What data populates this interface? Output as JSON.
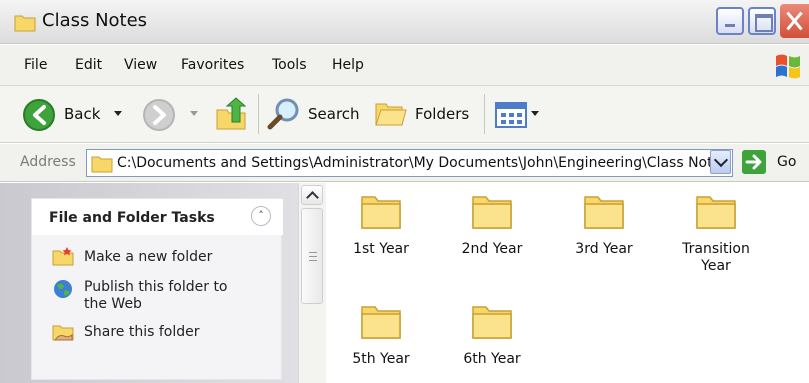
{
  "window": {
    "title": "Class Notes"
  },
  "menu": [
    "File",
    "Edit",
    "View",
    "Favorites",
    "Tools",
    "Help"
  ],
  "toolbar": {
    "back_label": "Back",
    "search_label": "Search",
    "folders_label": "Folders"
  },
  "address": {
    "label": "Address",
    "value": "C:\\Documents and Settings\\Administrator\\My Documents\\John\\Engineering\\Class Notes",
    "go_label": "Go"
  },
  "tasks": {
    "title": "File and Folder Tasks",
    "items": [
      {
        "label_line1": "Make a new folder",
        "label_line2": "",
        "icon": "new-folder-icon"
      },
      {
        "label_line1": "Publish this folder to",
        "label_line2": "the Web",
        "icon": "globe-icon"
      },
      {
        "label_line1": "Share this folder",
        "label_line2": "",
        "icon": "shared-folder-icon"
      }
    ]
  },
  "folders": [
    {
      "line1": "1st Year",
      "line2": ""
    },
    {
      "line1": "2nd Year",
      "line2": ""
    },
    {
      "line1": "3rd Year",
      "line2": ""
    },
    {
      "line1": "Transition",
      "line2": "Year"
    },
    {
      "line1": "5th Year",
      "line2": ""
    },
    {
      "line1": "6th Year",
      "line2": ""
    }
  ],
  "colors": {
    "folder_fill": "#f7d768",
    "folder_stroke": "#c8a033",
    "close_red": "#d24f38",
    "go_green": "#2f9a2b"
  }
}
